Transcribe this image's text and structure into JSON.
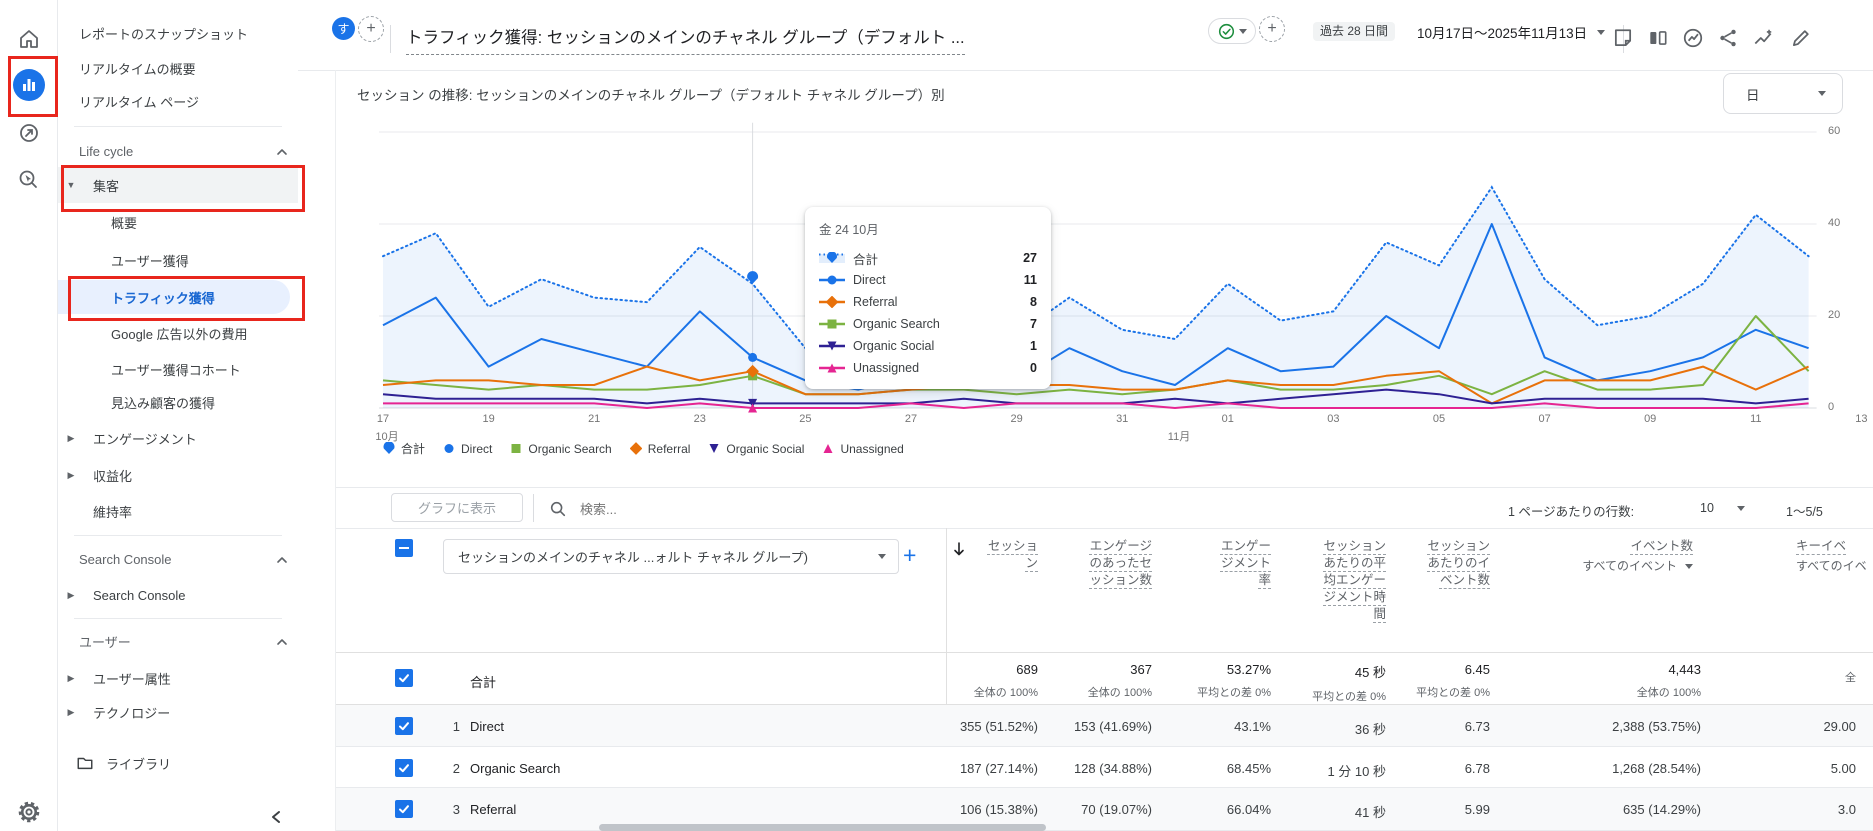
{
  "annotation": {
    "color": "#e8261d"
  },
  "rail": {
    "items": [
      {
        "icon": "home",
        "name": "home"
      },
      {
        "icon": "reports",
        "name": "reports",
        "active": true
      },
      {
        "icon": "explore",
        "name": "explore"
      },
      {
        "icon": "advertising",
        "name": "advertising"
      }
    ],
    "settings_icon": "settings"
  },
  "sidebar": {
    "items": [
      {
        "type": "link",
        "name": "reports-snapshot",
        "label": "レポートのスナップショット"
      },
      {
        "type": "link",
        "name": "realtime-overview",
        "label": "リアルタイムの概要"
      },
      {
        "type": "link",
        "name": "realtime-pages",
        "label": "リアルタイム ページ"
      },
      {
        "type": "divider"
      },
      {
        "type": "section",
        "name": "life-cycle",
        "label": "Life cycle"
      },
      {
        "type": "parent",
        "name": "acquisition",
        "label": "集客",
        "state": "expanded"
      },
      {
        "type": "child",
        "name": "acquisition-overview",
        "label": "概要"
      },
      {
        "type": "child",
        "name": "user-acquisition",
        "label": "ユーザー獲得"
      },
      {
        "type": "child",
        "name": "traffic-acquisition",
        "label": "トラフィック獲得",
        "active": true
      },
      {
        "type": "child",
        "name": "non-google-ads-cost",
        "label": "Google 広告以外の費用"
      },
      {
        "type": "child",
        "name": "user-acquisition-cohorts",
        "label": "ユーザー獲得コホート"
      },
      {
        "type": "child",
        "name": "lead-generation",
        "label": "見込み顧客の獲得"
      },
      {
        "type": "parent",
        "name": "engagement",
        "label": "エンゲージメント",
        "state": "collapsed"
      },
      {
        "type": "parent",
        "name": "monetization",
        "label": "収益化",
        "state": "collapsed"
      },
      {
        "type": "plain",
        "name": "retention",
        "label": "維持率"
      },
      {
        "type": "divider"
      },
      {
        "type": "section",
        "name": "search-console-section",
        "label": "Search Console"
      },
      {
        "type": "parent",
        "name": "search-console",
        "label": "Search Console",
        "state": "collapsed"
      },
      {
        "type": "divider"
      },
      {
        "type": "section",
        "name": "user-section",
        "label": "ユーザー"
      },
      {
        "type": "parent",
        "name": "user-attributes",
        "label": "ユーザー属性",
        "state": "collapsed"
      },
      {
        "type": "parent",
        "name": "technology",
        "label": "テクノロジー",
        "state": "collapsed"
      },
      {
        "type": "library",
        "name": "library",
        "label": "ライブラリ"
      }
    ]
  },
  "header": {
    "avatar_letter": "す",
    "title": "トラフィック獲得: セッションのメインのチャネル グループ（デフォルト ...",
    "date_preset": "過去 28 日間",
    "date_range": "10月17日～2025年11月13日"
  },
  "chart": {
    "title": "セッション の推移: セッションのメインのチャネル グループ（デフォルト チャネル グループ）別",
    "granularity": "日",
    "legend": [
      "合計",
      "Direct",
      "Organic Search",
      "Referral",
      "Organic Social",
      "Unassigned"
    ],
    "tooltip": {
      "date": "金 24 10月",
      "rows": [
        {
          "label": "合計",
          "value": "27"
        },
        {
          "label": "Direct",
          "value": "11"
        },
        {
          "label": "Referral",
          "value": "8"
        },
        {
          "label": "Organic Search",
          "value": "7"
        },
        {
          "label": "Organic Social",
          "value": "1"
        },
        {
          "label": "Unassigned",
          "value": "0"
        }
      ]
    }
  },
  "chart_data": {
    "type": "line",
    "title": "セッション の推移: セッションのメインのチャネル グループ（デフォルト チャネル グループ）別",
    "x": [
      "10/17",
      "10/18",
      "10/19",
      "10/20",
      "10/21",
      "10/22",
      "10/23",
      "10/24",
      "10/25",
      "10/26",
      "10/27",
      "10/28",
      "10/29",
      "10/30",
      "10/31",
      "11/01",
      "11/02",
      "11/03",
      "11/04",
      "11/05",
      "11/06",
      "11/07",
      "11/08",
      "11/09",
      "11/10",
      "11/11",
      "11/12",
      "11/13"
    ],
    "x_tick_labels": [
      "17",
      "19",
      "21",
      "23",
      "25",
      "27",
      "29",
      "31",
      "01",
      "03",
      "05",
      "07",
      "09",
      "11",
      "13"
    ],
    "month_labels": [
      {
        "index": 0,
        "label": "10月"
      },
      {
        "index": 15,
        "label": "11月"
      }
    ],
    "ylim": [
      0,
      60
    ],
    "y_ticks": [
      60,
      40,
      20,
      0
    ],
    "grid": "horizontal",
    "legend_position": "bottom",
    "hover_index": 7,
    "series": [
      {
        "name": "合計",
        "color": "#1a73e8",
        "style": "dotted-area",
        "marker": "pin",
        "values": [
          33,
          38,
          22,
          28,
          24,
          23,
          35,
          27,
          13,
          11,
          17,
          21,
          16,
          24,
          17,
          15,
          27,
          19,
          21,
          36,
          31,
          48,
          28,
          18,
          20,
          27,
          42,
          33
        ]
      },
      {
        "name": "Direct",
        "color": "#1a73e8",
        "style": "solid",
        "marker": "circle",
        "values": [
          18,
          24,
          9,
          15,
          12,
          9,
          21,
          11,
          6,
          4,
          7,
          10,
          6,
          13,
          8,
          5,
          13,
          8,
          9,
          20,
          13,
          40,
          11,
          6,
          8,
          11,
          17,
          13
        ]
      },
      {
        "name": "Organic Search",
        "color": "#7cb342",
        "style": "solid",
        "marker": "square",
        "values": [
          6,
          5,
          4,
          5,
          4,
          4,
          5,
          7,
          3,
          3,
          4,
          4,
          3,
          4,
          3,
          4,
          6,
          4,
          4,
          5,
          7,
          3,
          8,
          4,
          4,
          5,
          20,
          8
        ]
      },
      {
        "name": "Referral",
        "color": "#e8710a",
        "style": "solid",
        "marker": "diamond",
        "values": [
          5,
          6,
          6,
          5,
          5,
          9,
          6,
          8,
          3,
          3,
          4,
          5,
          5,
          5,
          4,
          4,
          6,
          5,
          5,
          7,
          8,
          1,
          6,
          6,
          6,
          9,
          4,
          9
        ]
      },
      {
        "name": "Organic Social",
        "color": "#2e2193",
        "style": "solid",
        "marker": "tri-down",
        "values": [
          3,
          2,
          2,
          2,
          2,
          1,
          2,
          1,
          1,
          1,
          1,
          2,
          1,
          1,
          1,
          2,
          1,
          2,
          3,
          4,
          3,
          1,
          2,
          2,
          2,
          2,
          1,
          2
        ]
      },
      {
        "name": "Unassigned",
        "color": "#e52592",
        "style": "solid",
        "marker": "tri-up",
        "values": [
          1,
          1,
          1,
          1,
          1,
          0,
          1,
          0,
          0,
          0,
          1,
          0,
          1,
          1,
          1,
          0,
          1,
          0,
          0,
          0,
          0,
          0,
          1,
          0,
          0,
          0,
          0,
          1
        ]
      }
    ]
  },
  "table": {
    "show_on_chart_button": "グラフに表示",
    "search_placeholder": "検索...",
    "rows_per_page_label": "1 ページあたりの行数:",
    "rows_per_page_value": "10",
    "pagination": "1～5/5",
    "dimension_dropdown": "セッションのメインのチャネル ...ォルト チャネル グループ)",
    "columns": [
      {
        "title": "セッション"
      },
      {
        "title": "エンゲージのあったセッション数"
      },
      {
        "title": "エンゲージメント率"
      },
      {
        "title": "セッションあたりの平均エンゲージメント時間"
      },
      {
        "title": "セッションあたりのイベント数"
      },
      {
        "title": "イベント数",
        "sub": "すべてのイベント"
      },
      {
        "title": "キーイベ",
        "sub": "すべてのイベ"
      }
    ],
    "totals": {
      "label": "合計",
      "cells": [
        {
          "value": "689",
          "sub": "全体の 100%"
        },
        {
          "value": "367",
          "sub": "全体の 100%"
        },
        {
          "value": "53.27%",
          "sub": "平均との差 0%"
        },
        {
          "value": "45 秒",
          "sub": "平均との差 0%"
        },
        {
          "value": "6.45",
          "sub": "平均との差 0%"
        },
        {
          "value": "4,443",
          "sub": "全体の 100%"
        },
        {
          "value": "",
          "sub": "全"
        }
      ]
    },
    "rows": [
      {
        "index": "1",
        "channel": "Direct",
        "cells": [
          "355 (51.52%)",
          "153 (41.69%)",
          "43.1%",
          "36 秒",
          "6.73",
          "2,388 (53.75%)",
          "29.00"
        ]
      },
      {
        "index": "2",
        "channel": "Organic Search",
        "cells": [
          "187 (27.14%)",
          "128 (34.88%)",
          "68.45%",
          "1 分 10 秒",
          "6.78",
          "1,268 (28.54%)",
          "5.00"
        ]
      },
      {
        "index": "3",
        "channel": "Referral",
        "cells": [
          "106 (15.38%)",
          "70 (19.07%)",
          "66.04%",
          "41 秒",
          "5.99",
          "635 (14.29%)",
          "3.0"
        ]
      }
    ]
  }
}
